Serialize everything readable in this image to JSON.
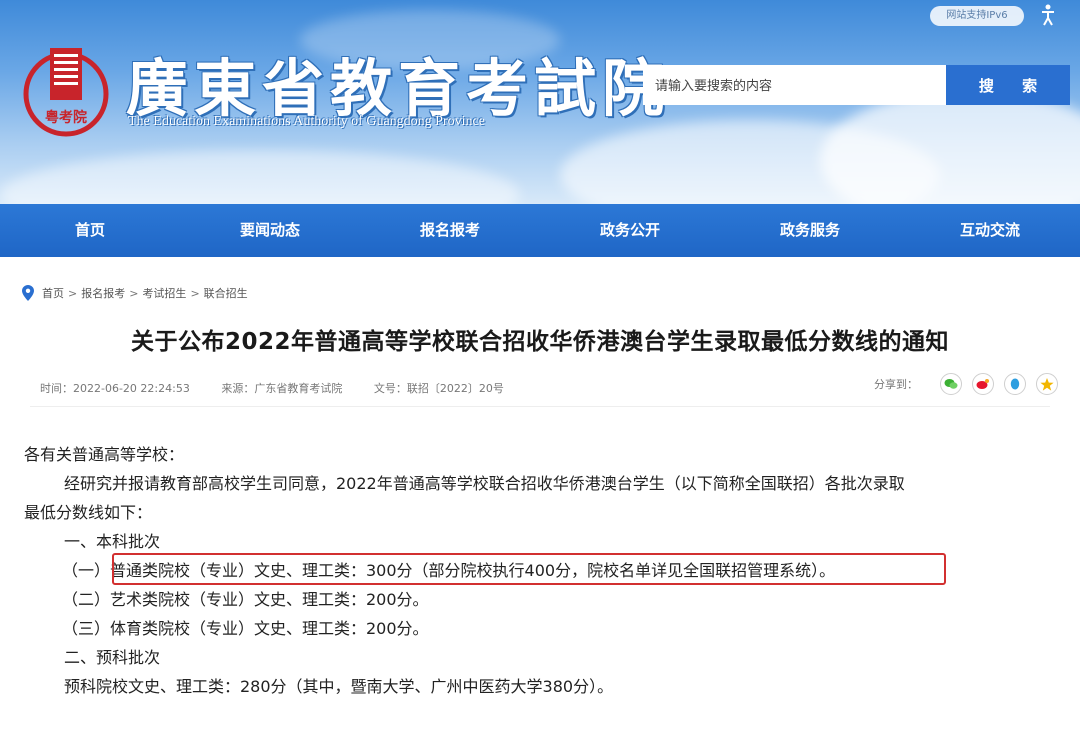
{
  "header": {
    "site_title": "廣東省教育考試院",
    "site_subtitle": "The Education Examinations Authority of Guangdong Province",
    "ipv6_badge": "网站支持IPv6",
    "logo_text": "粤考院",
    "search": {
      "placeholder": "请输入要搜索的内容",
      "button_label": "搜 索"
    }
  },
  "nav": {
    "items": [
      {
        "label": "首页"
      },
      {
        "label": "要闻动态"
      },
      {
        "label": "报名报考"
      },
      {
        "label": "政务公开"
      },
      {
        "label": "政务服务"
      },
      {
        "label": "互动交流"
      }
    ]
  },
  "breadcrumb": [
    "首页",
    "报名报考",
    "考试招生",
    "联合招生"
  ],
  "article": {
    "title": "关于公布2022年普通高等学校联合招收华侨港澳台学生录取最低分数线的通知",
    "meta": {
      "time": "时间：2022-06-20 22:24:53",
      "source": "来源：广东省教育考试院",
      "doc_no": "文号：联招〔2022〕20号"
    },
    "share_label": "分享到：",
    "paragraphs": {
      "greeting": "各有关普通高等学校：",
      "intro_line1": "经研究并报请教育部高校学生司同意，2022年普通高等学校联合招收华侨港澳台学生（以下简称全国联招）各批次录取",
      "intro_line2": "最低分数线如下：",
      "section1": "一、本科批次",
      "item1": "（一）普通类院校（专业）文史、理工类：300分（部分院校执行400分，院校名单详见全国联招管理系统）。",
      "item2": "（二）艺术类院校（专业）文史、理工类：200分。",
      "item3": "（三）体育类院校（专业）文史、理工类：200分。",
      "section2": "二、预科批次",
      "prep": "预科院校文史、理工类：280分（其中，暨南大学、广州中医药大学380分）。"
    }
  },
  "colors": {
    "nav_blue": "#2a6fd0",
    "highlight_red": "#d23030",
    "logo_red": "#c8242b"
  }
}
